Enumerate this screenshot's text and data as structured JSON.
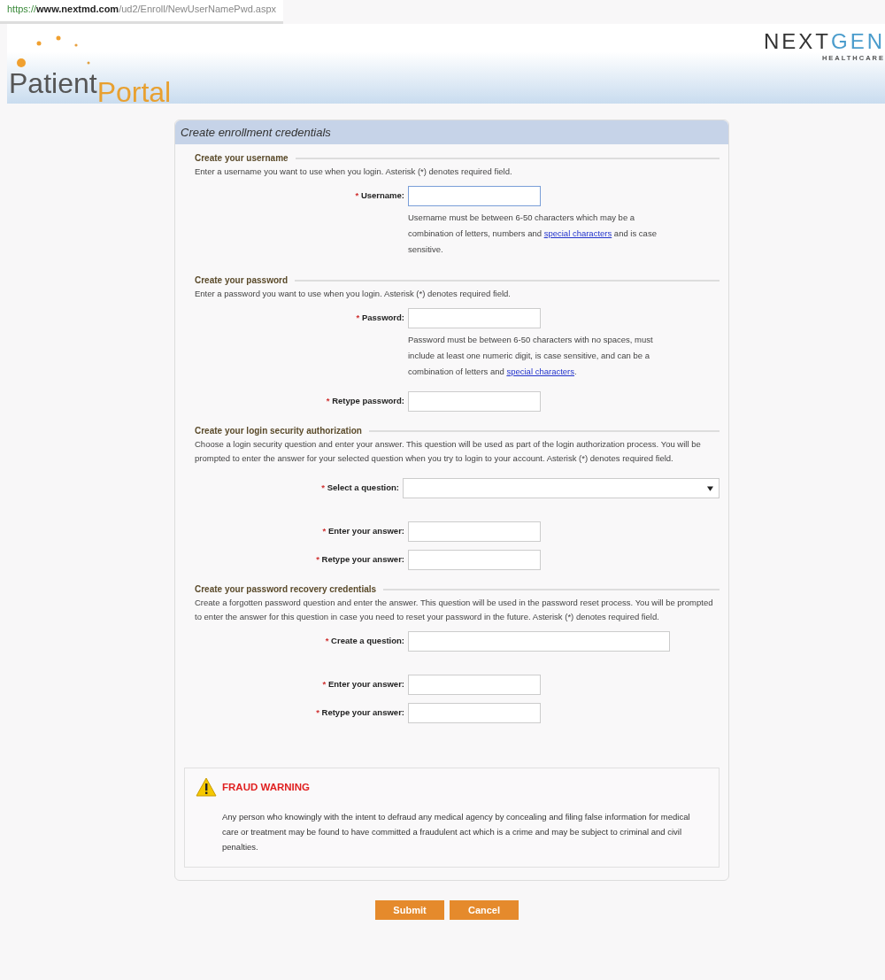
{
  "address_bar": {
    "scheme": "https://",
    "host": "www.nextmd.com",
    "path": "/ud2/Enroll/NewUserNamePwd.aspx"
  },
  "header": {
    "logo_first": "Patient",
    "logo_second": "Portal",
    "brand_first": "NEXT",
    "brand_second": "GEN",
    "brand_sub": "HEALTHCARE"
  },
  "panel": {
    "title": "Create enrollment credentials",
    "sections": [
      {
        "heading": "Create your username",
        "description": "Enter a username you want to use when you login. Asterisk (*) denotes required field.",
        "fields": [
          {
            "kind": "text",
            "mark": "*",
            "label": "Username:",
            "focused": true,
            "hint": [
              {
                "text": "Username must be between 6-50 characters which may be a combination of letters, numbers and "
              },
              {
                "link": "special characters"
              },
              {
                "text": " and is case sensitive."
              }
            ]
          }
        ]
      },
      {
        "heading": "Create your password",
        "description": "Enter a password you want to use when you login. Asterisk (*) denotes required field.",
        "fields": [
          {
            "kind": "text",
            "mark": "*",
            "label": "Password:",
            "focused": false,
            "hint": [
              {
                "text": "Password must be between 6-50 characters with no spaces, must include at least one numeric digit, is case sensitive, and can be a combination of letters and "
              },
              {
                "link": "special characters"
              },
              {
                "text": "."
              }
            ]
          },
          {
            "kind": "text",
            "mark": "*",
            "label": "Retype password:",
            "focused": false
          }
        ]
      },
      {
        "heading": "Create your login security authorization",
        "description": "Choose a login security question and enter your answer. This question will be used as part of the login authorization process. You will be prompted to enter the answer for your selected question when you try to login to your account. Asterisk (*) denotes required field.",
        "fields": [
          {
            "kind": "select",
            "mark": "*",
            "label": "Select a question:",
            "focused": false
          },
          {
            "kind": "text",
            "mark": "*",
            "label": "Enter your answer:",
            "focused": false
          },
          {
            "kind": "text",
            "mark": "*",
            "label": "Retype your answer:",
            "focused": false
          }
        ]
      },
      {
        "heading": "Create your password recovery credentials",
        "description": "Create a forgotten password question and enter the answer. This question will be used in the password reset process. You will be prompted to enter the answer for this question in case you need to reset your password in the future. Asterisk (*) denotes required field.",
        "fields": [
          {
            "kind": "wide",
            "mark": "*",
            "label": "Create a question:",
            "focused": false
          },
          {
            "kind": "text",
            "mark": "*",
            "label": "Enter your answer:",
            "focused": false
          },
          {
            "kind": "text",
            "mark": "*",
            "label": "Retype your answer:",
            "focused": false
          }
        ]
      }
    ],
    "warning": {
      "title": "FRAUD WARNING",
      "body": "Any person who knowingly with the intent to defraud any medical agency by concealing and filing false information for medical care or treatment may be found to have committed a fraudulent act which is a crime and may be subject to criminal and civil penalties."
    }
  },
  "buttons": [
    {
      "label": "Submit"
    },
    {
      "label": "Cancel"
    }
  ]
}
